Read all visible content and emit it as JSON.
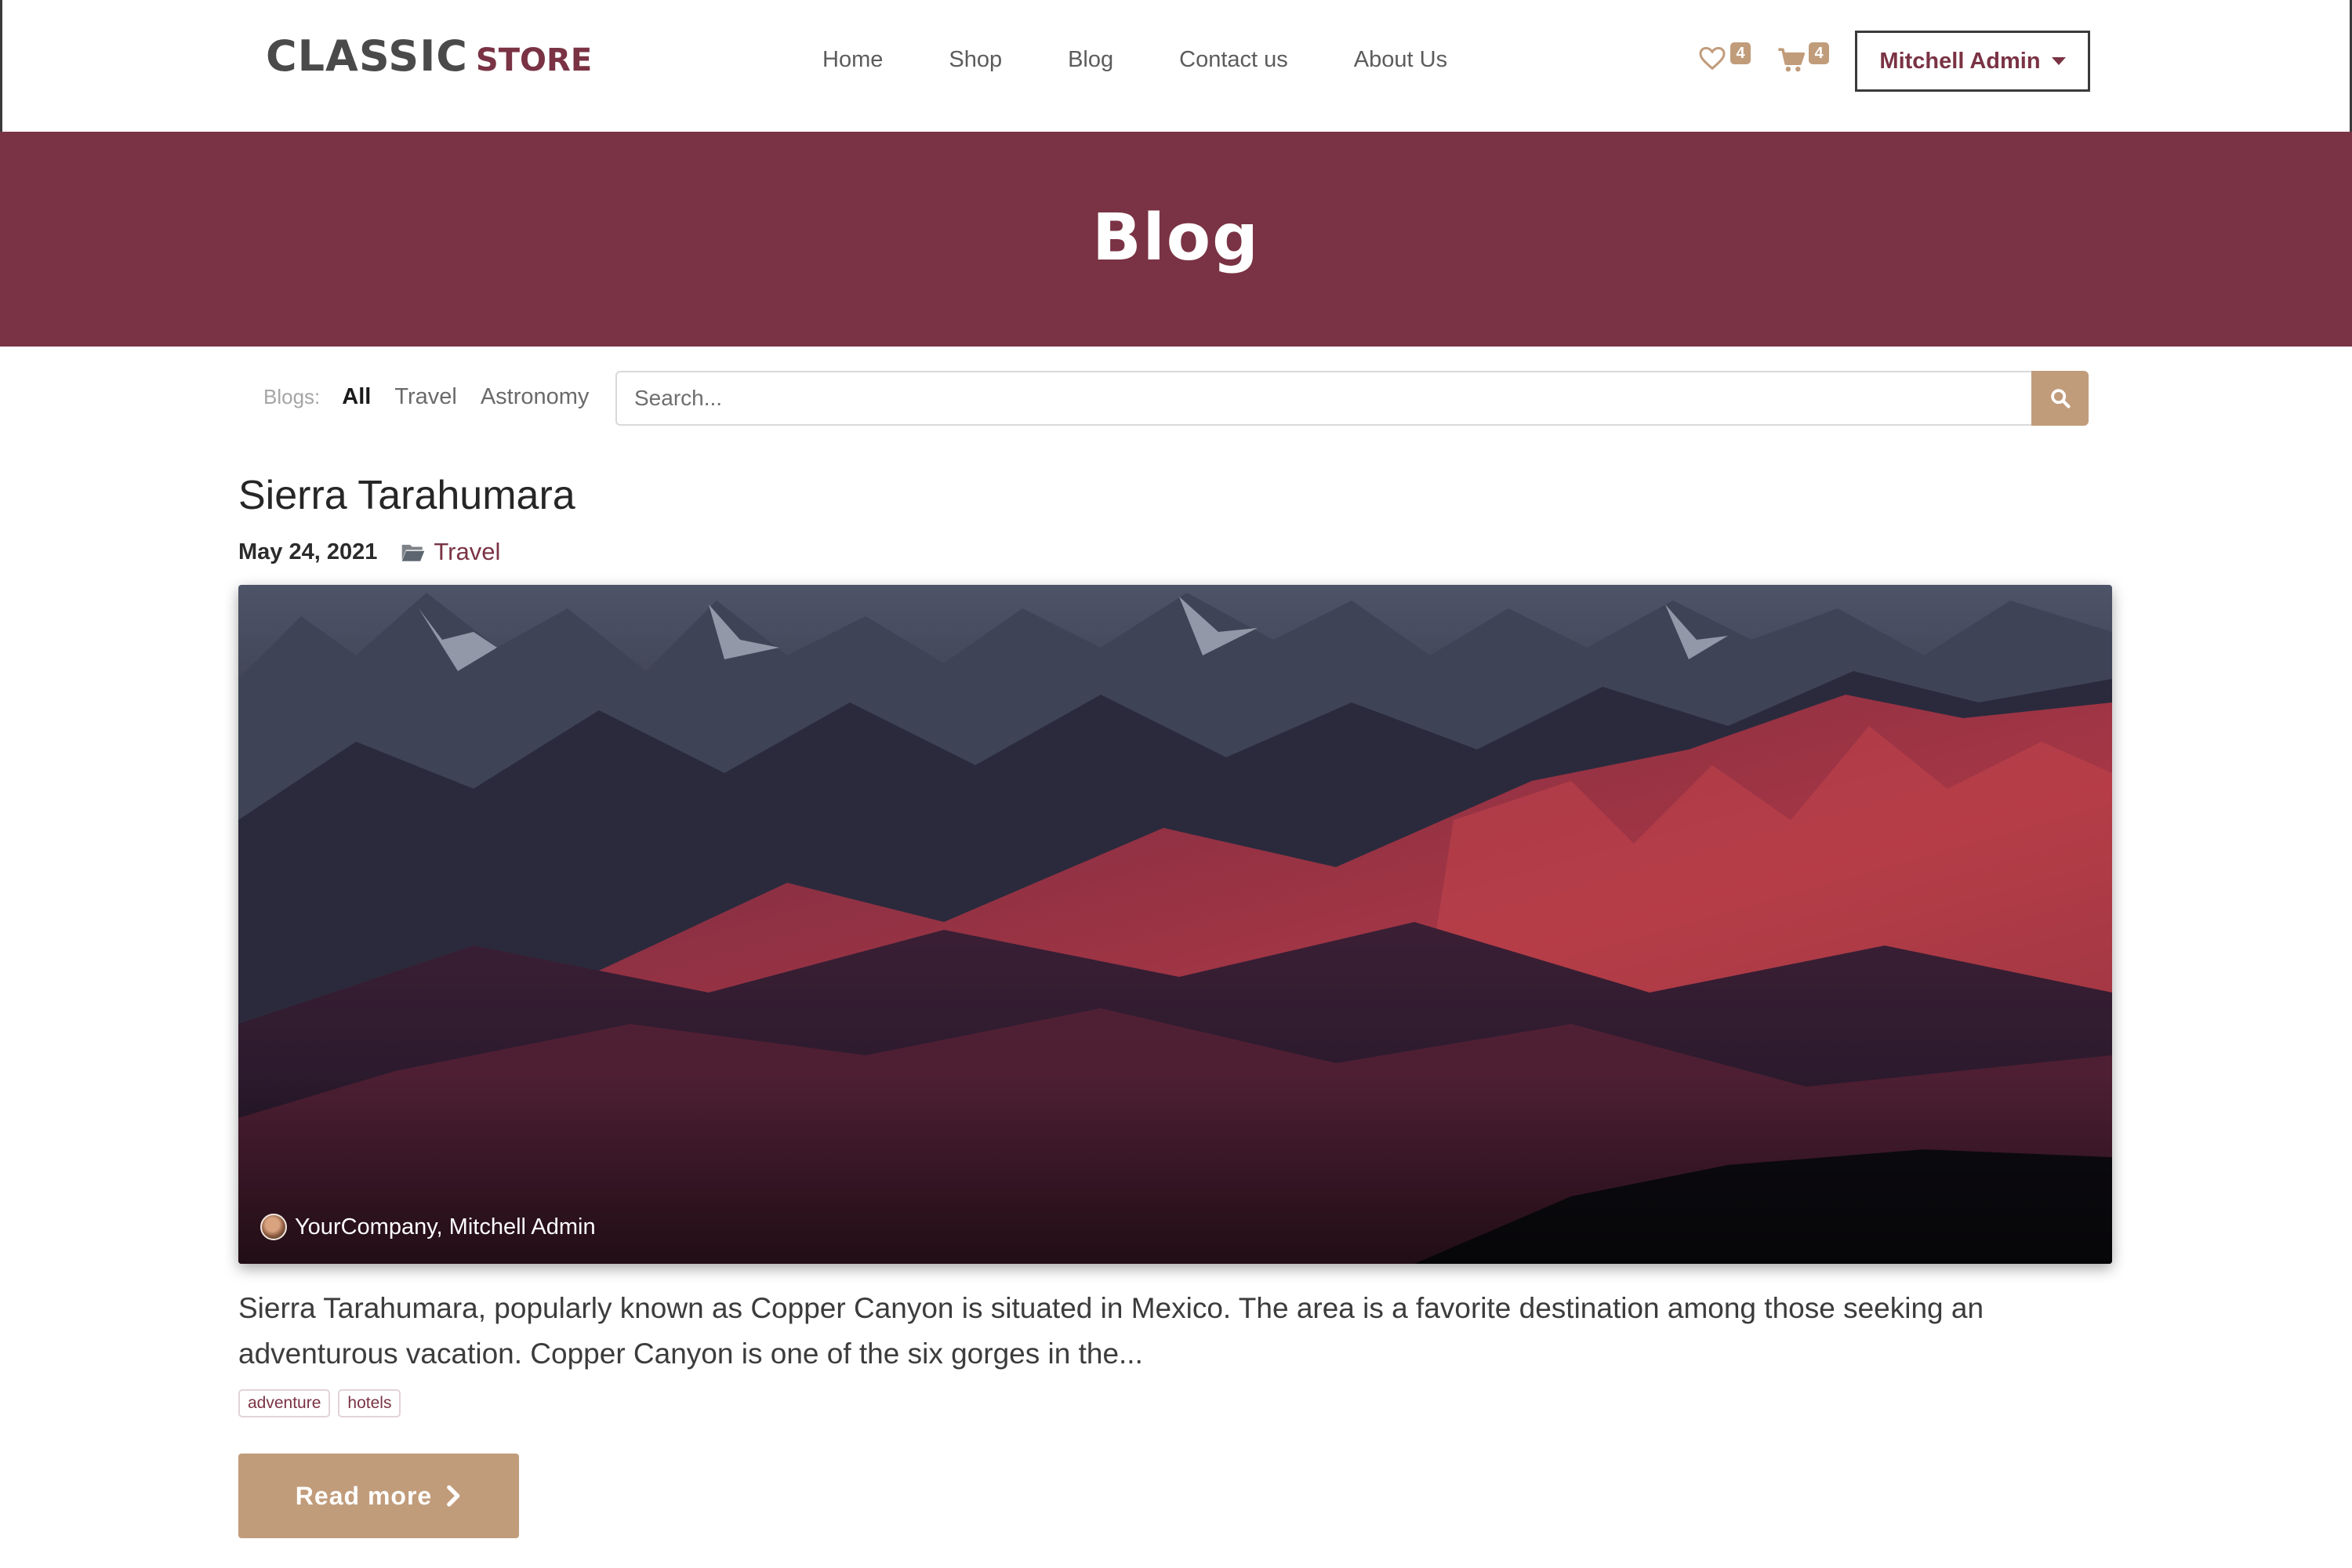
{
  "header": {
    "logo_main": "CLASSIC",
    "logo_sub": "STORE",
    "nav": [
      "Home",
      "Shop",
      "Blog",
      "Contact us",
      "About Us"
    ],
    "wishlist_count": "4",
    "cart_count": "4",
    "user_label": "Mitchell Admin"
  },
  "hero": {
    "title": "Blog"
  },
  "filters": {
    "label": "Blogs:",
    "options": [
      "All",
      "Travel",
      "Astronomy"
    ],
    "active": "All",
    "search_placeholder": "Search..."
  },
  "post": {
    "title": "Sierra Tarahumara",
    "date": "May 24, 2021",
    "category": "Travel",
    "author": "YourCompany, Mitchell Admin",
    "teaser": "Sierra Tarahumara, popularly known as Copper Canyon is situated in Mexico. The area is a favorite destination among those seeking an adventurous vacation. Copper Canyon is one of the six gorges in the...",
    "tags": [
      "adventure",
      "hotels"
    ],
    "read_more": "Read more"
  },
  "icons": [
    "heart-icon",
    "cart-icon",
    "search-icon",
    "folder-icon",
    "chevron-right-icon",
    "caret-down-icon"
  ],
  "colors": {
    "brand": "#7a3344",
    "accent": "#c19c7b"
  }
}
